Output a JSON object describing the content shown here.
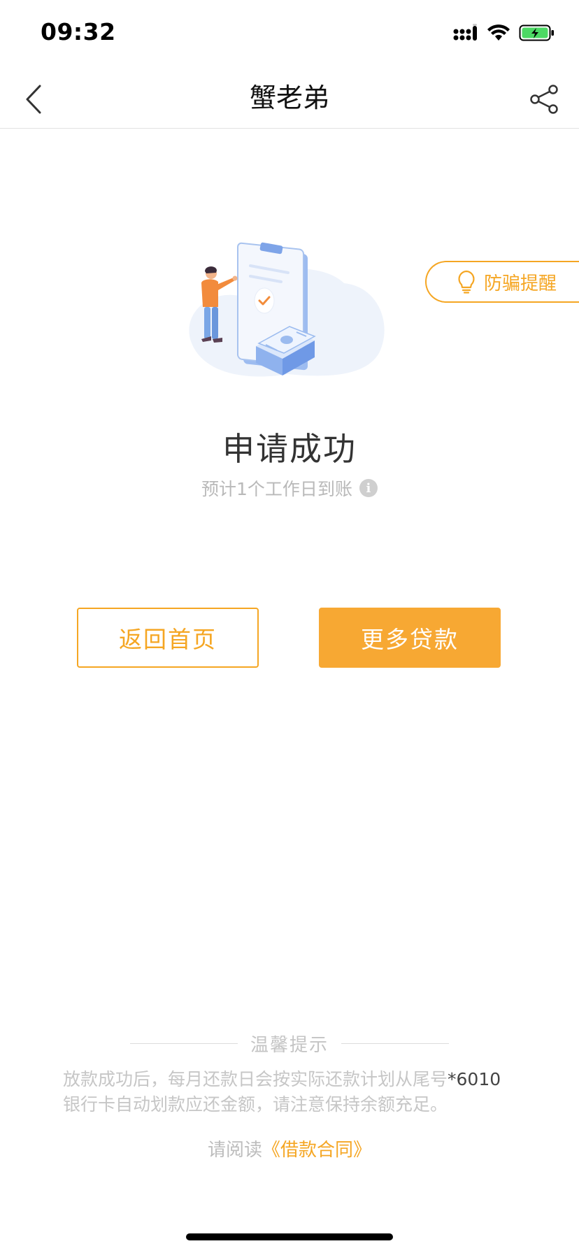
{
  "status_bar": {
    "time": "09:32",
    "icons": [
      "signal-icon",
      "wifi-icon",
      "battery-charging-icon"
    ]
  },
  "nav": {
    "title": "蟹老弟",
    "back_icon": "chevron-left-icon",
    "share_icon": "share-icon"
  },
  "fraud_reminder": {
    "label": "防骗提醒",
    "icon": "lightbulb-icon"
  },
  "result": {
    "title": "申请成功",
    "subtitle": "预计1个工作日到账",
    "info_icon_glyph": "i"
  },
  "buttons": {
    "home_label": "返回首页",
    "more_label": "更多贷款"
  },
  "tips": {
    "title": "温馨提示",
    "body_main": "放款成功后，每月还款日会按实际还款计划从尾号",
    "body_card": "*6010",
    "body_rest": "银行卡自动划款应还金额，请注意保持余额充足。",
    "read_prefix": "请阅读",
    "contract_link": "《借款合同》"
  },
  "colors": {
    "accent": "#f5a623",
    "button_fill": "#f7a833",
    "muted_text": "#bdbdbd"
  }
}
